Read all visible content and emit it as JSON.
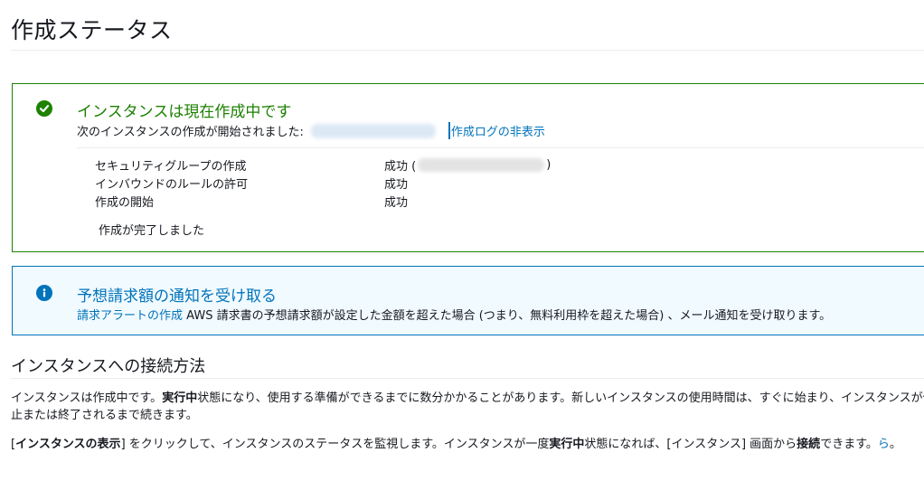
{
  "page": {
    "title": "作成ステータス"
  },
  "status_box": {
    "title": "インスタンスは現在作成中です",
    "subtitle": "次のインスタンスの作成が開始されました:",
    "toggle_log_label": "作成ログの非表示",
    "steps": [
      {
        "name": "セキュリティグループの作成",
        "status_prefix": "成功 (",
        "status_suffix": ")"
      },
      {
        "name": "インバウンドのルールの許可",
        "status": "成功"
      },
      {
        "name": "作成の開始",
        "status": "成功"
      }
    ],
    "complete_message": "作成が完了しました"
  },
  "billing_box": {
    "title": "予想請求額の通知を受け取る",
    "link_label": "請求アラートの作成",
    "description": "AWS 請求書の予想請求額が設定した金額を超えた場合 (つまり、無料利用枠を超えた場合) 、メール通知を受け取ります。"
  },
  "connect_section": {
    "heading": "インスタンスへの接続方法",
    "para1": {
      "t1": "インスタンスは作成中です。",
      "b1": "実行中",
      "t2": "状態になり、使用する準備ができるまでに数分かかることがあります。新しいインスタンスの使用時間は、すぐに始まり、インスタンスが停止または終了されるまで続きます。"
    },
    "para2": {
      "t1": "[",
      "b1": "インスタンスの表示",
      "t2": "] をクリックして、インスタンスのステータスを監視します。インスタンスが一度",
      "b2": "実行中",
      "t3": "状態になれば、[インスタンス] 画面から",
      "b3": "接続",
      "t4": "できます。",
      "link_tail": "ら",
      "t5": "。"
    }
  },
  "colors": {
    "success": "#1d8102",
    "info": "#0073bb",
    "info_bg": "#f1faff"
  },
  "icons": {
    "success": "check-circle-icon",
    "info": "info-circle-icon"
  }
}
